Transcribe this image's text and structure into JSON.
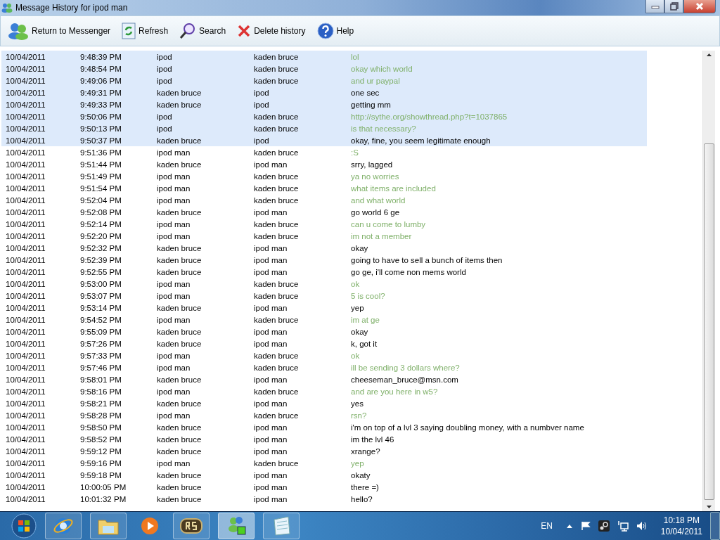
{
  "window": {
    "title": "Message History for ipod man"
  },
  "toolbar": [
    "Return to Messenger",
    "Refresh",
    "Search",
    "Delete history",
    "Help"
  ],
  "messages": [
    {
      "date": "10/04/2011",
      "time": "9:48:39 PM",
      "from": "ipod",
      "to": "kaden bruce",
      "text": "lol",
      "kind": "sent",
      "selected": true
    },
    {
      "date": "10/04/2011",
      "time": "9:48:54 PM",
      "from": "ipod",
      "to": "kaden bruce",
      "text": "okay which world",
      "kind": "sent",
      "selected": true
    },
    {
      "date": "10/04/2011",
      "time": "9:49:06 PM",
      "from": "ipod",
      "to": "kaden bruce",
      "text": "and ur paypal",
      "kind": "sent",
      "selected": true
    },
    {
      "date": "10/04/2011",
      "time": "9:49:31 PM",
      "from": "kaden bruce",
      "to": "ipod",
      "text": "one sec",
      "kind": "received",
      "selected": true
    },
    {
      "date": "10/04/2011",
      "time": "9:49:33 PM",
      "from": "kaden bruce",
      "to": "ipod",
      "text": "getting mm",
      "kind": "received",
      "selected": true
    },
    {
      "date": "10/04/2011",
      "time": "9:50:06 PM",
      "from": "ipod",
      "to": "kaden bruce",
      "text": "http://sythe.org/showthread.php?t=1037865",
      "kind": "sent",
      "selected": true
    },
    {
      "date": "10/04/2011",
      "time": "9:50:13 PM",
      "from": "ipod",
      "to": "kaden bruce",
      "text": "is that necessary?",
      "kind": "sent",
      "selected": true
    },
    {
      "date": "10/04/2011",
      "time": "9:50:37 PM",
      "from": "kaden bruce",
      "to": "ipod",
      "text": "okay, fine, you seem legitimate enough",
      "kind": "received",
      "selected": true
    },
    {
      "date": "10/04/2011",
      "time": "9:51:36 PM",
      "from": "ipod man",
      "to": "kaden bruce",
      "text": ":S",
      "kind": "sent",
      "selected": false
    },
    {
      "date": "10/04/2011",
      "time": "9:51:44 PM",
      "from": "kaden bruce",
      "to": "ipod man",
      "text": "srry, lagged",
      "kind": "received",
      "selected": false
    },
    {
      "date": "10/04/2011",
      "time": "9:51:49 PM",
      "from": "ipod man",
      "to": "kaden bruce",
      "text": "ya no worries",
      "kind": "sent",
      "selected": false
    },
    {
      "date": "10/04/2011",
      "time": "9:51:54 PM",
      "from": "ipod man",
      "to": "kaden bruce",
      "text": "what items are included",
      "kind": "sent",
      "selected": false
    },
    {
      "date": "10/04/2011",
      "time": "9:52:04 PM",
      "from": "ipod man",
      "to": "kaden bruce",
      "text": "and what world",
      "kind": "sent",
      "selected": false
    },
    {
      "date": "10/04/2011",
      "time": "9:52:08 PM",
      "from": "kaden bruce",
      "to": "ipod man",
      "text": "go world 6 ge",
      "kind": "received",
      "selected": false
    },
    {
      "date": "10/04/2011",
      "time": "9:52:14 PM",
      "from": "ipod man",
      "to": "kaden bruce",
      "text": "can u come to lumby",
      "kind": "sent",
      "selected": false
    },
    {
      "date": "10/04/2011",
      "time": "9:52:20 PM",
      "from": "ipod man",
      "to": "kaden bruce",
      "text": "im not a member",
      "kind": "sent",
      "selected": false
    },
    {
      "date": "10/04/2011",
      "time": "9:52:32 PM",
      "from": "kaden bruce",
      "to": "ipod man",
      "text": "okay",
      "kind": "received",
      "selected": false
    },
    {
      "date": "10/04/2011",
      "time": "9:52:39 PM",
      "from": "kaden bruce",
      "to": "ipod man",
      "text": "going to have to sell a bunch of items then",
      "kind": "received",
      "selected": false
    },
    {
      "date": "10/04/2011",
      "time": "9:52:55 PM",
      "from": "kaden bruce",
      "to": "ipod man",
      "text": "go ge, i'll come non mems world",
      "kind": "received",
      "selected": false
    },
    {
      "date": "10/04/2011",
      "time": "9:53:00 PM",
      "from": "ipod man",
      "to": "kaden bruce",
      "text": "ok",
      "kind": "sent",
      "selected": false
    },
    {
      "date": "10/04/2011",
      "time": "9:53:07 PM",
      "from": "ipod man",
      "to": "kaden bruce",
      "text": "5 is cool?",
      "kind": "sent",
      "selected": false
    },
    {
      "date": "10/04/2011",
      "time": "9:53:14 PM",
      "from": "kaden bruce",
      "to": "ipod man",
      "text": "yep",
      "kind": "received",
      "selected": false
    },
    {
      "date": "10/04/2011",
      "time": "9:54:52 PM",
      "from": "ipod man",
      "to": "kaden bruce",
      "text": "im at ge",
      "kind": "sent",
      "selected": false
    },
    {
      "date": "10/04/2011",
      "time": "9:55:09 PM",
      "from": "kaden bruce",
      "to": "ipod man",
      "text": "okay",
      "kind": "received",
      "selected": false
    },
    {
      "date": "10/04/2011",
      "time": "9:57:26 PM",
      "from": "kaden bruce",
      "to": "ipod man",
      "text": "k, got it",
      "kind": "received",
      "selected": false
    },
    {
      "date": "10/04/2011",
      "time": "9:57:33 PM",
      "from": "ipod man",
      "to": "kaden bruce",
      "text": "ok",
      "kind": "sent",
      "selected": false
    },
    {
      "date": "10/04/2011",
      "time": "9:57:46 PM",
      "from": "ipod man",
      "to": "kaden bruce",
      "text": "ill be sending 3 dollars where?",
      "kind": "sent",
      "selected": false
    },
    {
      "date": "10/04/2011",
      "time": "9:58:01 PM",
      "from": "kaden bruce",
      "to": "ipod man",
      "text": "cheeseman_bruce@msn.com",
      "kind": "received",
      "selected": false
    },
    {
      "date": "10/04/2011",
      "time": "9:58:16 PM",
      "from": "ipod man",
      "to": "kaden bruce",
      "text": "and are you here in w5?",
      "kind": "sent",
      "selected": false
    },
    {
      "date": "10/04/2011",
      "time": "9:58:21 PM",
      "from": "kaden bruce",
      "to": "ipod man",
      "text": "yes",
      "kind": "received",
      "selected": false
    },
    {
      "date": "10/04/2011",
      "time": "9:58:28 PM",
      "from": "ipod man",
      "to": "kaden bruce",
      "text": "rsn?",
      "kind": "sent",
      "selected": false
    },
    {
      "date": "10/04/2011",
      "time": "9:58:50 PM",
      "from": "kaden bruce",
      "to": "ipod man",
      "text": "i'm on top of a lvl 3 saying doubling money, with a numbver name",
      "kind": "received",
      "selected": false
    },
    {
      "date": "10/04/2011",
      "time": "9:58:52 PM",
      "from": "kaden bruce",
      "to": "ipod man",
      "text": "im the lvl 46",
      "kind": "received",
      "selected": false
    },
    {
      "date": "10/04/2011",
      "time": "9:59:12 PM",
      "from": "kaden bruce",
      "to": "ipod man",
      "text": "xrange?",
      "kind": "received",
      "selected": false
    },
    {
      "date": "10/04/2011",
      "time": "9:59:16 PM",
      "from": "ipod man",
      "to": "kaden bruce",
      "text": "yep",
      "kind": "sent",
      "selected": false
    },
    {
      "date": "10/04/2011",
      "time": "9:59:18 PM",
      "from": "kaden bruce",
      "to": "ipod man",
      "text": "okaty",
      "kind": "received",
      "selected": false
    },
    {
      "date": "10/04/2011",
      "time": "10:00:05 PM",
      "from": "kaden bruce",
      "to": "ipod man",
      "text": "there =)",
      "kind": "received",
      "selected": false
    },
    {
      "date": "10/04/2011",
      "time": "10:01:32 PM",
      "from": "kaden bruce",
      "to": "ipod man",
      "text": "hello?",
      "kind": "received",
      "selected": false
    }
  ],
  "taskbar": {
    "apps": [
      {
        "kind": "browser",
        "selected": false
      },
      {
        "kind": "folder",
        "selected": false
      },
      {
        "kind": "media",
        "selected": false
      },
      {
        "kind": "game",
        "selected": false
      },
      {
        "kind": "messenger",
        "selected": true
      },
      {
        "kind": "notepad",
        "selected": false
      }
    ],
    "language": "EN",
    "time": "10:18 PM",
    "date": "10/04/2011"
  }
}
